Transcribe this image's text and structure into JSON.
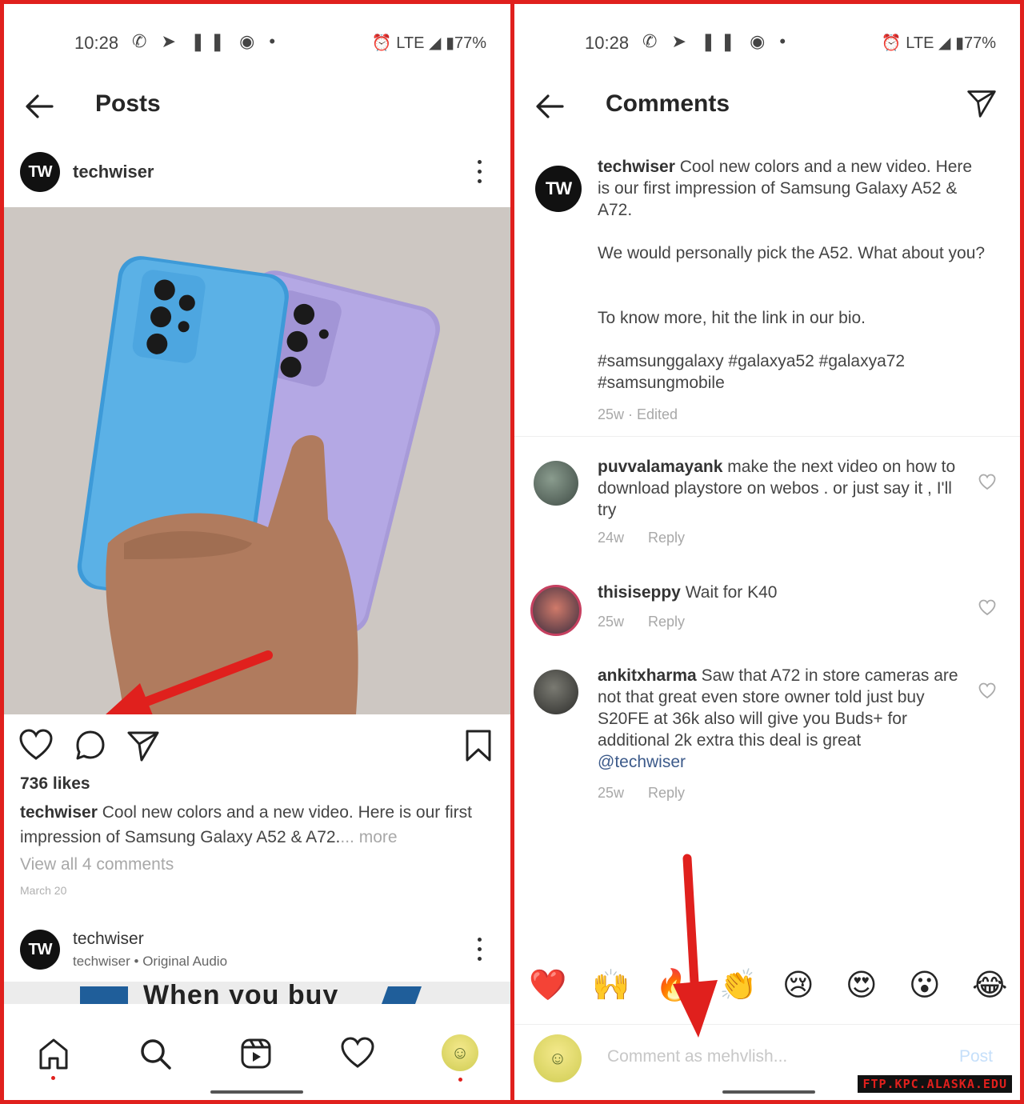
{
  "left_panel": {
    "status": {
      "time": "10:28",
      "network": "LTE",
      "battery": "77%"
    },
    "header_title": "Posts",
    "post": {
      "username": "techwiser",
      "avatar_initials": "TW",
      "likes": "736 likes",
      "caption_user": "techwiser",
      "caption_text": "Cool new colors and a new video. Here is our first impression of Samsung Galaxy A52 &  A72.",
      "caption_more": "... more",
      "view_all": "View all 4 comments",
      "date": "March 20"
    },
    "next_post": {
      "username": "techwiser",
      "subtitle": "techwiser • Original Audio",
      "avatar_initials": "TW",
      "preview_text": "When you buy"
    },
    "bottom_nav": [
      "home-icon",
      "search-icon",
      "reels-icon",
      "heart-icon",
      "profile-avatar"
    ]
  },
  "right_panel": {
    "status": {
      "time": "10:28",
      "network": "LTE",
      "battery": "77%"
    },
    "header_title": "Comments",
    "caption": {
      "username": "techwiser",
      "avatar_initials": "TW",
      "line1": "Cool new colors and a new video. Here is our first impression of Samsung Galaxy A52 &  A72.",
      "line2": "We would personally pick the A52. What about you?",
      "line3": "To know more, hit the link in our bio.",
      "hashtags": "#samsunggalaxy #galaxya52 #galaxya72 #samsungmobile",
      "meta": "25w · Edited"
    },
    "comments": [
      {
        "username": "puvvalamayank",
        "text": "make the next video on how to download playstore on webos . or just say it , I'll try",
        "time": "24w",
        "reply": "Reply"
      },
      {
        "username": "thisiseppy",
        "text": "Wait for K40",
        "time": "25w",
        "reply": "Reply"
      },
      {
        "username": "ankitxharma",
        "text": "Saw that A72 in store cameras are not that great even store owner told just buy S20FE at 36k also will give you Buds+ for additional 2k extra this deal is great",
        "mention": "@techwiser",
        "time": "25w",
        "reply": "Reply"
      }
    ],
    "emojis": [
      "❤️",
      "🙌",
      "🔥",
      "👏",
      "😢",
      "😍",
      "😮",
      "😂"
    ],
    "comment_placeholder": "Comment as mehvlish...",
    "post_button": "Post"
  },
  "watermark": "FTP.KPC.ALASKA.EDU",
  "colors": {
    "frame": "#e0201d",
    "arrow": "#e0201d",
    "link": "#3c5a8a"
  }
}
